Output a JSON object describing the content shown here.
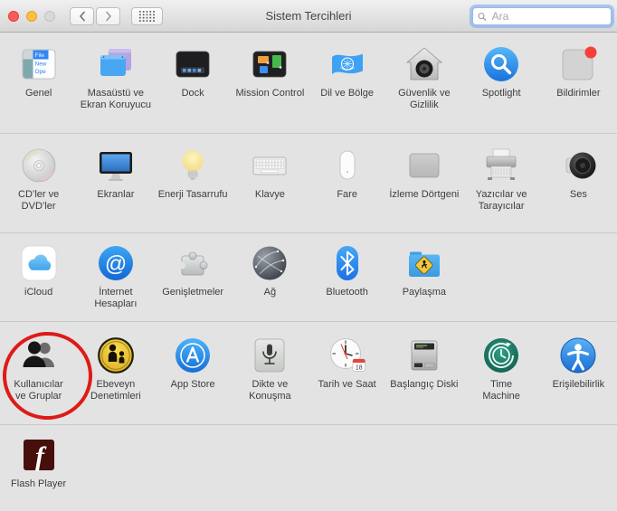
{
  "titlebar": {
    "title": "Sistem Tercihleri",
    "search_placeholder": "Ara"
  },
  "rows": [
    {
      "items": [
        {
          "id": "genel",
          "label": "Genel"
        },
        {
          "id": "masaustu-ekran-koruyucu",
          "label": "Masaüstü ve Ekran Koruyucu"
        },
        {
          "id": "dock",
          "label": "Dock"
        },
        {
          "id": "mission-control",
          "label": "Mission Control"
        },
        {
          "id": "dil-ve-bolge",
          "label": "Dil ve Bölge"
        },
        {
          "id": "guvenlik-ve-gizlilik",
          "label": "Güvenlik ve Gizlilik"
        },
        {
          "id": "spotlight",
          "label": "Spotlight"
        },
        {
          "id": "bildirimler",
          "label": "Bildirimler"
        }
      ]
    },
    {
      "items": [
        {
          "id": "cdler-ve-dvdler",
          "label": "CD’ler ve DVD’ler"
        },
        {
          "id": "ekranlar",
          "label": "Ekranlar"
        },
        {
          "id": "enerji-tasarrufu",
          "label": "Enerji Tasarrufu"
        },
        {
          "id": "klavye",
          "label": "Klavye"
        },
        {
          "id": "fare",
          "label": "Fare"
        },
        {
          "id": "izleme-dortgeni",
          "label": "İzleme Dörtgeni"
        },
        {
          "id": "yazicilar-ve-tarayicilar",
          "label": "Yazıcılar ve Tarayıcılar"
        },
        {
          "id": "ses",
          "label": "Ses"
        }
      ]
    },
    {
      "items": [
        {
          "id": "icloud",
          "label": "iCloud"
        },
        {
          "id": "internet-hesaplari",
          "label": "İnternet Hesapları"
        },
        {
          "id": "genisletmeler",
          "label": "Genişletmeler"
        },
        {
          "id": "ag",
          "label": "Ağ"
        },
        {
          "id": "bluetooth",
          "label": "Bluetooth"
        },
        {
          "id": "paylasma",
          "label": "Paylaşma"
        }
      ]
    },
    {
      "items": [
        {
          "id": "kullanicilar-ve-gruplar",
          "label": "Kullanıcılar ve Gruplar"
        },
        {
          "id": "ebeveyn-denetimleri",
          "label": "Ebeveyn Denetimleri"
        },
        {
          "id": "app-store",
          "label": "App Store"
        },
        {
          "id": "dikte-ve-konusma",
          "label": "Dikte ve Konuşma"
        },
        {
          "id": "tarih-ve-saat",
          "label": "Tarih ve Saat"
        },
        {
          "id": "baslangic-diski",
          "label": "Başlangıç Diski"
        },
        {
          "id": "time-machine",
          "label": "Time Machine"
        },
        {
          "id": "erisilebilirlik",
          "label": "Erişilebilirlik"
        }
      ]
    },
    {
      "items": [
        {
          "id": "flash-player",
          "label": "Flash Player"
        }
      ]
    }
  ],
  "icon_texts": {
    "genel_menu_file": "File",
    "genel_menu_new": "New",
    "genel_menu_open": "Ope",
    "internet_at": "@",
    "calendar_day": "18"
  },
  "annotation": {
    "shape": "ellipse",
    "color": "#dd1b18",
    "target": "Kullanıcılar ve Gruplar"
  },
  "colors": {
    "window_background": "#e3e3e3",
    "search_focus_ring": "#6ea5f5",
    "annotation_red": "#dd1b18"
  }
}
